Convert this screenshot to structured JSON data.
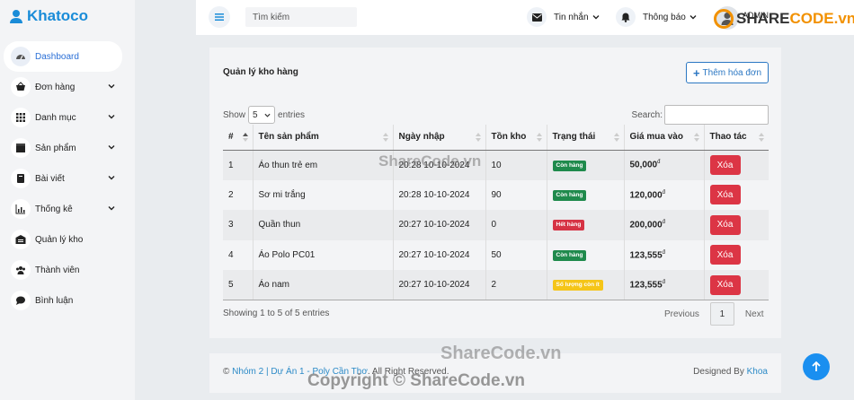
{
  "brand": {
    "name": "Khatoco"
  },
  "sidebar": {
    "items": [
      {
        "label": "Dashboard",
        "icon": "dashboard-icon",
        "active": true,
        "has_dropdown": false
      },
      {
        "label": "Đơn hàng",
        "icon": "basket-icon",
        "active": false,
        "has_dropdown": true
      },
      {
        "label": "Danh mục",
        "icon": "grid-icon",
        "active": false,
        "has_dropdown": true
      },
      {
        "label": "Sản phẩm",
        "icon": "box-icon",
        "active": false,
        "has_dropdown": true
      },
      {
        "label": "Bài viết",
        "icon": "book-icon",
        "active": false,
        "has_dropdown": true
      },
      {
        "label": "Thống kê",
        "icon": "chart-icon",
        "active": false,
        "has_dropdown": true
      },
      {
        "label": "Quản lý kho",
        "icon": "warehouse-icon",
        "active": false,
        "has_dropdown": false
      },
      {
        "label": "Thành viên",
        "icon": "users-icon",
        "active": false,
        "has_dropdown": false
      },
      {
        "label": "Bình luận",
        "icon": "comment-icon",
        "active": false,
        "has_dropdown": false
      }
    ]
  },
  "topbar": {
    "search_placeholder": "Tìm kiếm",
    "messages_label": "Tin nhắn",
    "notifications_label": "Thông báo",
    "user_label": "ADMIN"
  },
  "card": {
    "title": "Quản lý kho hàng",
    "add_button": "Thêm hóa đơn",
    "show_label": "Show",
    "show_value": "5",
    "entries_label": "entries",
    "search_label": "Search:",
    "columns": [
      "#",
      "Tên sản phẩm",
      "Ngày nhập",
      "Tồn kho",
      "Trạng thái",
      "Giá mua vào",
      "Thao tác"
    ],
    "rows": [
      {
        "no": "1",
        "name": "Áo thun trẻ em",
        "date": "20:28 10-10-2024",
        "stock": "10",
        "status": "Còn hàng",
        "status_color": "#1f8a4c",
        "price": "50,000",
        "currency": "đ",
        "action": "Xóa"
      },
      {
        "no": "2",
        "name": "Sơ mi trắng",
        "date": "20:28 10-10-2024",
        "stock": "90",
        "status": "Còn hàng",
        "status_color": "#1f8a4c",
        "price": "120,000",
        "currency": "đ",
        "action": "Xóa"
      },
      {
        "no": "3",
        "name": "Quần thun",
        "date": "20:27 10-10-2024",
        "stock": "0",
        "status": "Hết hàng",
        "status_color": "#d63344",
        "price": "200,000",
        "currency": "đ",
        "action": "Xóa"
      },
      {
        "no": "4",
        "name": "Áo Polo PC01",
        "date": "20:27 10-10-2024",
        "stock": "50",
        "status": "Còn hàng",
        "status_color": "#1f8a4c",
        "price": "123,555",
        "currency": "đ",
        "action": "Xóa"
      },
      {
        "no": "5",
        "name": "Áo nam",
        "date": "20:27 10-10-2024",
        "stock": "2",
        "status": "Số lượng còn ít",
        "status_color": "#f5c518",
        "price": "123,555",
        "currency": "đ",
        "action": "Xóa"
      }
    ],
    "showing_text": "Showing 1 to 5 of 5 entries",
    "pager": {
      "previous": "Previous",
      "current": "1",
      "next": "Next"
    }
  },
  "footer": {
    "copyright_symbol": "©",
    "left_link": "Nhóm 2 | Dự Án 1 - Poly Cần Thơ",
    "left_suffix": "All Right Reserved.",
    "right_prefix": "Designed By",
    "right_link": "Khoa"
  },
  "watermarks": {
    "top_right_a": "SHARE",
    "top_right_b": "CODE.vn",
    "middle": "ShareCode.vn",
    "bottom": "ShareCode.vn",
    "copyright": "Copyright © ShareCode.vn"
  },
  "colors": {
    "accent": "#1a8cd8",
    "danger": "#dc3545",
    "success": "#1f8a4c",
    "warning": "#f5c518"
  }
}
